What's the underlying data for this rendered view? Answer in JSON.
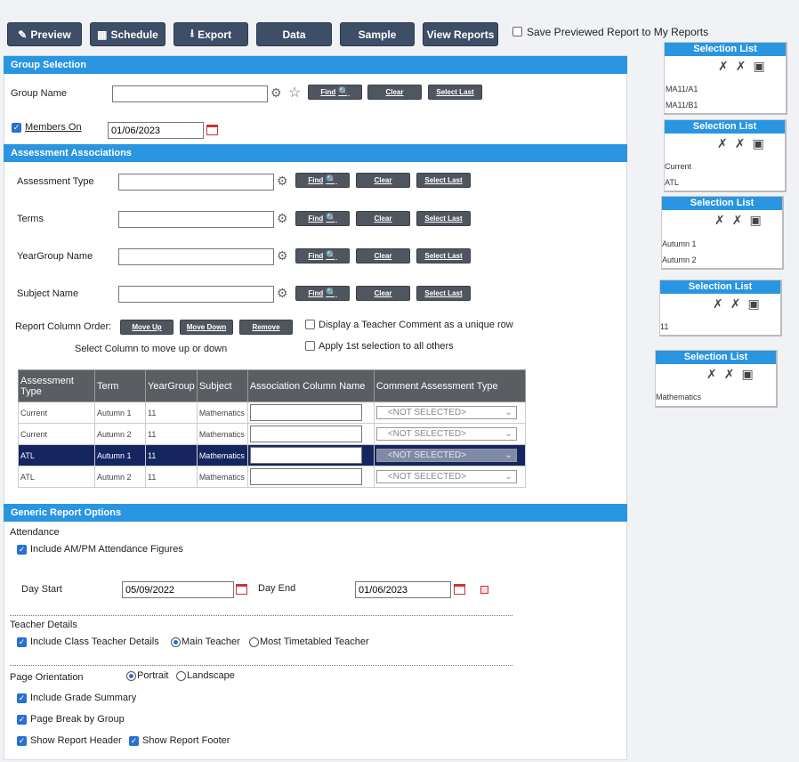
{
  "toolbar": {
    "preview": "Preview",
    "schedule": "Schedule",
    "export": "Export",
    "data": "Data",
    "sample": "Sample",
    "view_reports": "View Reports",
    "save_previewed": "Save Previewed Report to My Reports"
  },
  "group_selection": {
    "header": "Group Selection",
    "group_name_label": "Group Name",
    "group_name_value": "",
    "members_on_label": "Members On",
    "members_on_value": "01/06/2023"
  },
  "buttons": {
    "find": "Find",
    "clear": "Clear",
    "select_last": "Select Last"
  },
  "assessment": {
    "header": "Assessment Associations",
    "assessment_type_label": "Assessment Type",
    "terms_label": "Terms",
    "yeargroup_label": "YearGroup Name",
    "subject_label": "Subject Name",
    "report_column_order": "Report Column Order:",
    "move_up": "Move Up",
    "move_down": "Move Down",
    "remove": "Remove",
    "select_hint": "Select Column to move up or down",
    "display_teacher_comment": "Display a Teacher Comment as a unique row",
    "apply_first": "Apply 1st selection to all others"
  },
  "table": {
    "columns": [
      "Assessment Type",
      "Term",
      "YearGroup",
      "Subject",
      "Association Column Name",
      "Comment Assessment Type"
    ],
    "rows": [
      {
        "type": "Current",
        "term": "Autumn 1",
        "yeargroup": "11",
        "subject": "Mathematics",
        "comment": "<NOT SELECTED>"
      },
      {
        "type": "Current",
        "term": "Autumn 2",
        "yeargroup": "11",
        "subject": "Mathematics",
        "comment": "<NOT SELECTED>"
      },
      {
        "type": "ATL",
        "term": "Autumn 1",
        "yeargroup": "11",
        "subject": "Mathematics",
        "comment": "<NOT SELECTED>"
      },
      {
        "type": "ATL",
        "term": "Autumn 2",
        "yeargroup": "11",
        "subject": "Mathematics",
        "comment": "<NOT SELECTED>"
      }
    ]
  },
  "generic": {
    "header": "Generic Report Options",
    "attendance": "Attendance",
    "include_am_pm": "Include AM/PM Attendance Figures",
    "day_start_label": "Day Start",
    "day_start_value": "05/09/2022",
    "day_end_label": "Day End",
    "day_end_value": "01/06/2023",
    "teacher_details": "Teacher Details",
    "include_class_teacher": "Include Class Teacher Details",
    "main_teacher": "Main Teacher",
    "most_timetabled": "Most Timetabled Teacher",
    "page_orientation": "Page Orientation",
    "portrait": "Portrait",
    "landscape": "Landscape",
    "include_grade_summary": "Include Grade Summary",
    "page_break": "Page Break by Group",
    "show_header": "Show Report Header",
    "show_footer": "Show Report Footer"
  },
  "selection_lists": [
    {
      "title": "Selection List",
      "items": [
        "MA11/A1",
        "MA11/B1"
      ]
    },
    {
      "title": "Selection List",
      "items": [
        "Current",
        "ATL"
      ]
    },
    {
      "title": "Selection List",
      "items": [
        "Autumn 1",
        "Autumn 2"
      ]
    },
    {
      "title": "Selection List",
      "items": [
        "11"
      ]
    },
    {
      "title": "Selection List",
      "items": [
        "Mathematics"
      ]
    }
  ],
  "colors": {
    "accent": "#2a95e0",
    "button_dark": "#3d4e66",
    "selected_row": "#152560"
  }
}
